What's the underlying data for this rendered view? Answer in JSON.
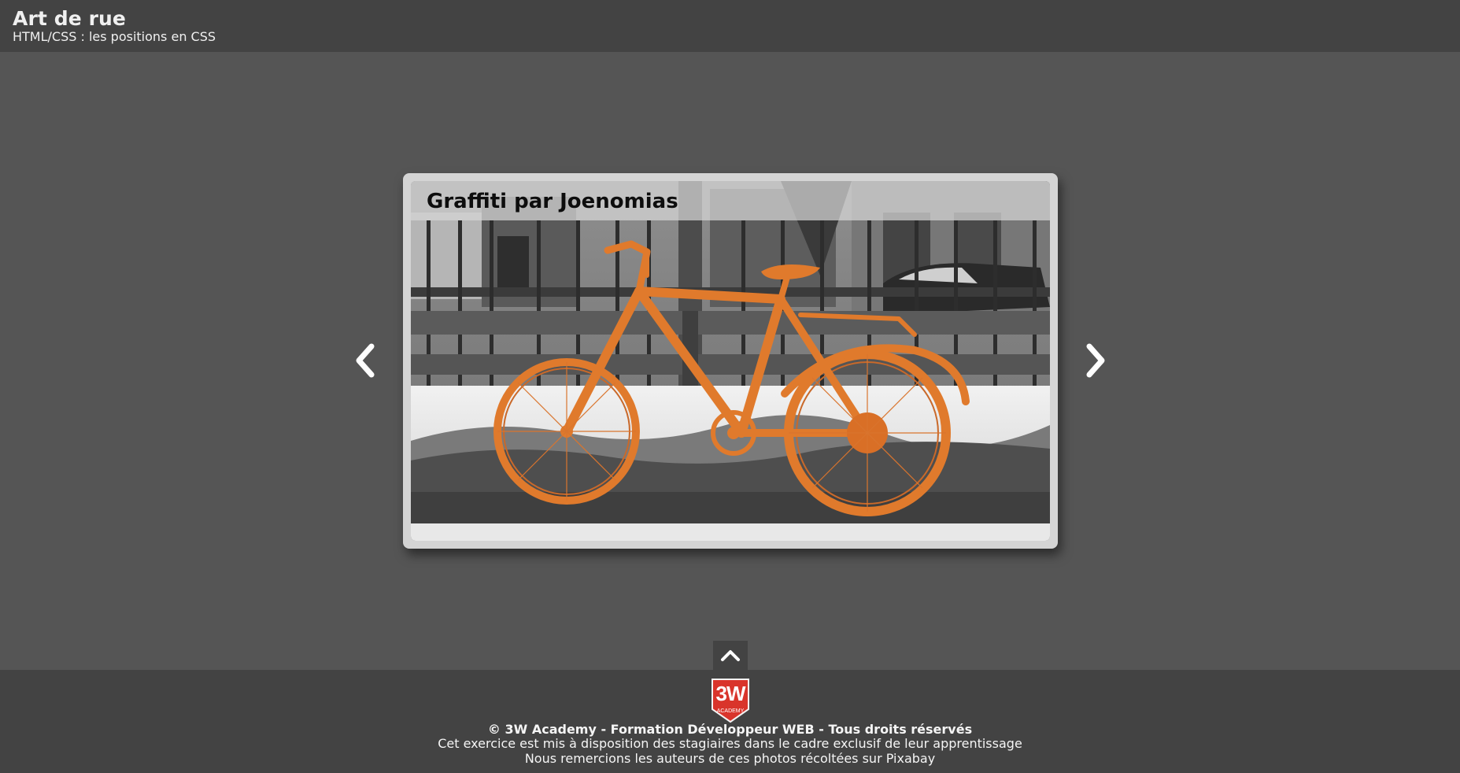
{
  "header": {
    "title": "Art de rue",
    "subtitle": "HTML/CSS : les positions en CSS"
  },
  "slider": {
    "caption": "Graffiti par Joenomias",
    "image_description": "orange-painted-bicycle",
    "prev_icon": "chevron-left-icon",
    "next_icon": "chevron-right-icon"
  },
  "back_to_top": {
    "icon": "chevron-up-icon"
  },
  "footer": {
    "logo_mark": "3W",
    "logo_sub": "ACADEMY",
    "copyright": "© 3W Academy - Formation Développeur WEB - Tous droits réservés",
    "line1": "Cet exercice est mis à disposition des stagiaires dans le cadre exclusif de leur apprentissage",
    "line2": "Nous remercions les auteurs de ces photos récoltées sur Pixabay"
  },
  "colors": {
    "page_bg": "#555555",
    "bar_bg": "#434343",
    "bike_orange": "#e07a2c",
    "logo_red": "#d9342b"
  }
}
